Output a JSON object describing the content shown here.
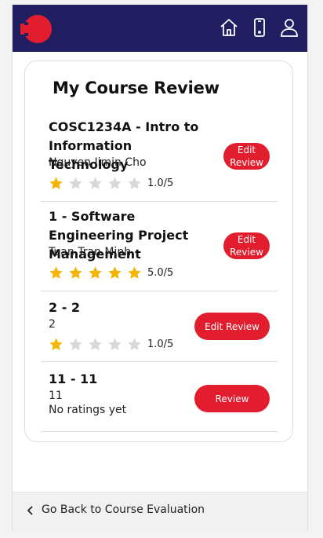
{
  "header": {
    "logo": "red-cross-logo",
    "icons": [
      "home-icon",
      "mobile-icon",
      "user-icon"
    ],
    "background": "#211e62"
  },
  "page": {
    "title": "My Course Review"
  },
  "reviews": [
    {
      "title": "COSC1234A - Intro to Information Technology",
      "subtitle": "Nguyen Jimin Cho",
      "rating": 1,
      "rating_text": "1.0/5",
      "button": "Edit Review"
    },
    {
      "title": "1 - Software Engineering Project Management",
      "subtitle": "Tuan Tran Minh",
      "rating": 5,
      "rating_text": "5.0/5",
      "button": "Edit Review"
    },
    {
      "title": "2 - 2",
      "subtitle": "2",
      "rating": 1,
      "rating_text": "1.0/5",
      "button": "Edit Review"
    },
    {
      "title": "11 - 11",
      "subtitle": "11",
      "rating": null,
      "no_rating_text": "No ratings yet",
      "button": "Review"
    }
  ],
  "footer": {
    "back_label": "Go Back to Course Evaluation"
  },
  "colors": {
    "accent": "#e21d2e",
    "star_filled": "#f5b400",
    "star_empty": "#d8d8d8"
  }
}
